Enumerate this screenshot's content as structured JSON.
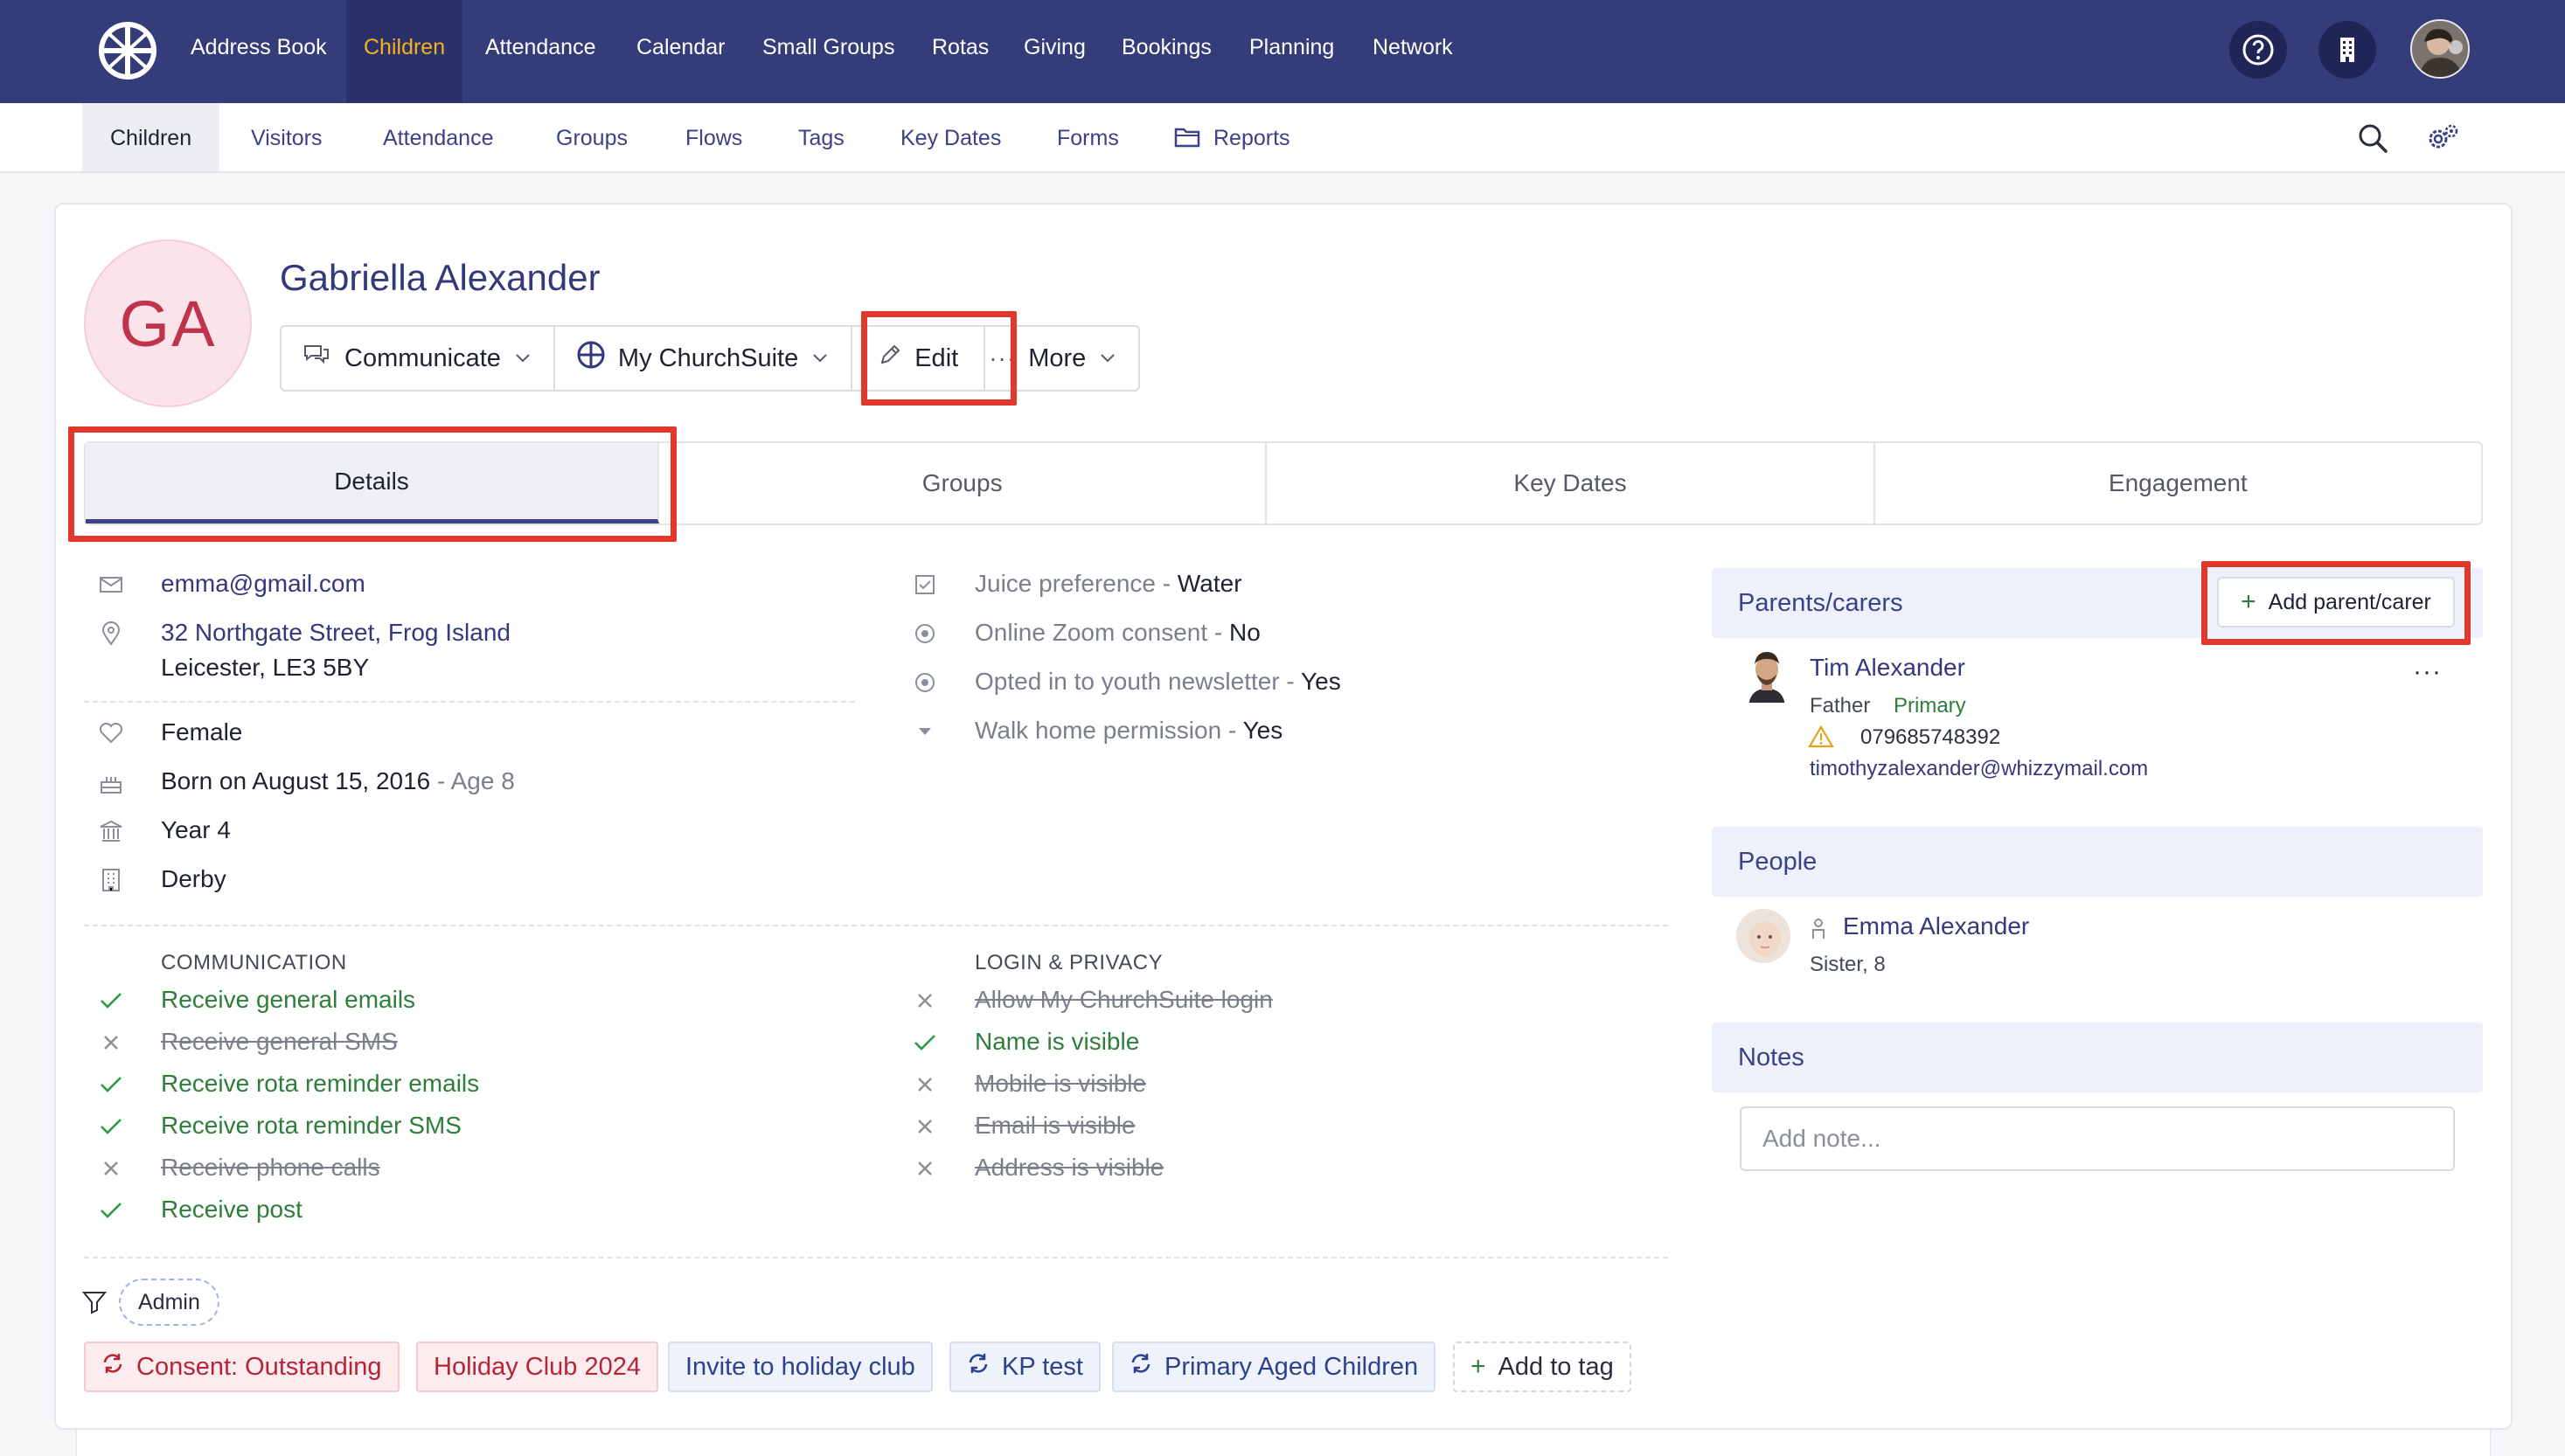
{
  "topnav": {
    "items": [
      "Address Book",
      "Children",
      "Attendance",
      "Calendar",
      "Small Groups",
      "Rotas",
      "Giving",
      "Bookings",
      "Planning",
      "Network"
    ],
    "active_index": 1,
    "icons": [
      "help-icon",
      "building-icon",
      "user-avatar"
    ]
  },
  "subnav": {
    "items": [
      "Children",
      "Visitors",
      "Attendance",
      "Groups",
      "Flows",
      "Tags",
      "Key Dates",
      "Forms",
      "Reports"
    ],
    "active_index": 0,
    "icons": [
      "search-icon",
      "settings-icon"
    ]
  },
  "person": {
    "initials": "GA",
    "name": "Gabriella Alexander"
  },
  "actions": {
    "communicate": "Communicate",
    "mychurchsuite": "My ChurchSuite",
    "edit": "Edit",
    "more": "More"
  },
  "tabs": [
    "Details",
    "Groups",
    "Key Dates",
    "Engagement"
  ],
  "details": {
    "email": "emma@gmail.com",
    "address_line1": "32 Northgate Street, Frog Island",
    "address_line2": "Leicester, LE3 5BY",
    "sex": "Female",
    "born": "Born on August 15, 2016",
    "age": " - Age 8",
    "school_year": "Year 4",
    "site": "Derby"
  },
  "custom_fields": [
    {
      "label": "Juice preference",
      "value": "Water"
    },
    {
      "label": "Online Zoom consent",
      "value": "No"
    },
    {
      "label": "Opted in to youth newsletter",
      "value": "Yes"
    },
    {
      "label": "Walk home permission",
      "value": "Yes"
    }
  ],
  "communication": {
    "title": "COMMUNICATION",
    "items": [
      {
        "label": "Receive general emails",
        "enabled": true
      },
      {
        "label": "Receive general SMS",
        "enabled": false
      },
      {
        "label": "Receive rota reminder emails",
        "enabled": true
      },
      {
        "label": "Receive rota reminder SMS",
        "enabled": true
      },
      {
        "label": "Receive phone calls",
        "enabled": false
      },
      {
        "label": "Receive post",
        "enabled": true
      }
    ]
  },
  "login_privacy": {
    "title": "LOGIN & PRIVACY",
    "items": [
      {
        "label": "Allow My ChurchSuite login",
        "enabled": false
      },
      {
        "label": "Name is visible",
        "enabled": true
      },
      {
        "label": "Mobile is visible",
        "enabled": false
      },
      {
        "label": "Email is visible",
        "enabled": false
      },
      {
        "label": "Address is visible",
        "enabled": false
      }
    ]
  },
  "filter_chip": "Admin",
  "tags": [
    {
      "label": "Consent: Outstanding",
      "style": "red",
      "icon": true
    },
    {
      "label": "Holiday Club 2024",
      "style": "red",
      "icon": false
    },
    {
      "label": "Invite to holiday club",
      "style": "blue",
      "icon": false
    },
    {
      "label": "KP test",
      "style": "blue",
      "icon": true
    },
    {
      "label": "Primary Aged Children",
      "style": "blue",
      "icon": true
    },
    {
      "label": "Add to tag",
      "style": "add",
      "icon": false
    }
  ],
  "parents": {
    "title": "Parents/carers",
    "add_label": "Add parent/carer",
    "items": [
      {
        "name": "Tim Alexander",
        "relation": "Father",
        "badge": "Primary",
        "phone": "079685748392",
        "email": "timothyzalexander@whizzymail.com"
      }
    ]
  },
  "people": {
    "title": "People",
    "items": [
      {
        "name": "Emma Alexander",
        "relation": "Sister, 8"
      }
    ]
  },
  "notes": {
    "title": "Notes",
    "placeholder": "Add note..."
  },
  "colors": {
    "nav_bg": "#343d7a",
    "nav_active": "#f5b21c",
    "link": "#33397a",
    "enabled": "#2f7d3a",
    "highlight": "#e0392b"
  }
}
